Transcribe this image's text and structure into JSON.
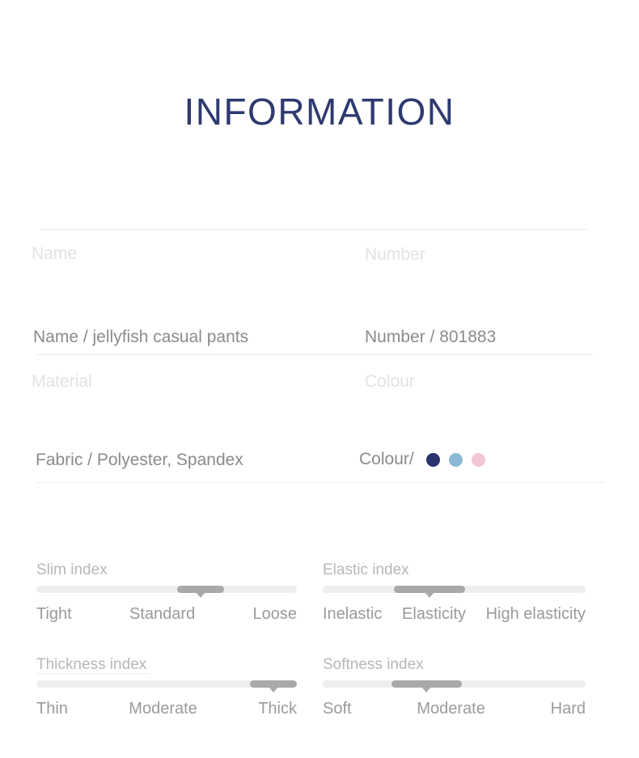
{
  "page": {
    "title": "INFORMATION",
    "title_color": "#2e3a70"
  },
  "fields": {
    "ghost_labels": {
      "name": "Name",
      "number": "Number",
      "material": "Material",
      "colour": "Colour"
    },
    "values": {
      "name": "Name / jellyfish casual pants",
      "number": "Number / 801883",
      "fabric": "Fabric / Polyester, Spandex",
      "colour_label": "Colour/"
    },
    "colours": [
      {
        "name": "navy-swatch",
        "hex": "#2b3270"
      },
      {
        "name": "light-blue-swatch",
        "hex": "#8cbad6"
      },
      {
        "name": "pink-swatch",
        "hex": "#f2c6d4"
      }
    ]
  },
  "indexes": [
    {
      "key": "slim",
      "title": "Slim index",
      "labels": [
        "Tight",
        "Standard",
        "Loose"
      ],
      "thumb_start_pct": 54,
      "thumb_width_pct": 18,
      "selected": "Standard"
    },
    {
      "key": "elastic",
      "title": "Elastic index",
      "labels": [
        "Inelastic",
        "Elasticity",
        "High elasticity"
      ],
      "thumb_start_pct": 27,
      "thumb_width_pct": 27,
      "selected": "Elasticity"
    },
    {
      "key": "thickness",
      "title": "Thickness index",
      "labels": [
        "Thin",
        "Moderate",
        "Thick"
      ],
      "thumb_start_pct": 82,
      "thumb_width_pct": 18,
      "selected": "Thick"
    },
    {
      "key": "softness",
      "title": "Softness index",
      "labels": [
        "Soft",
        "Moderate",
        "Hard"
      ],
      "thumb_start_pct": 26,
      "thumb_width_pct": 27,
      "selected": "Moderate"
    }
  ]
}
